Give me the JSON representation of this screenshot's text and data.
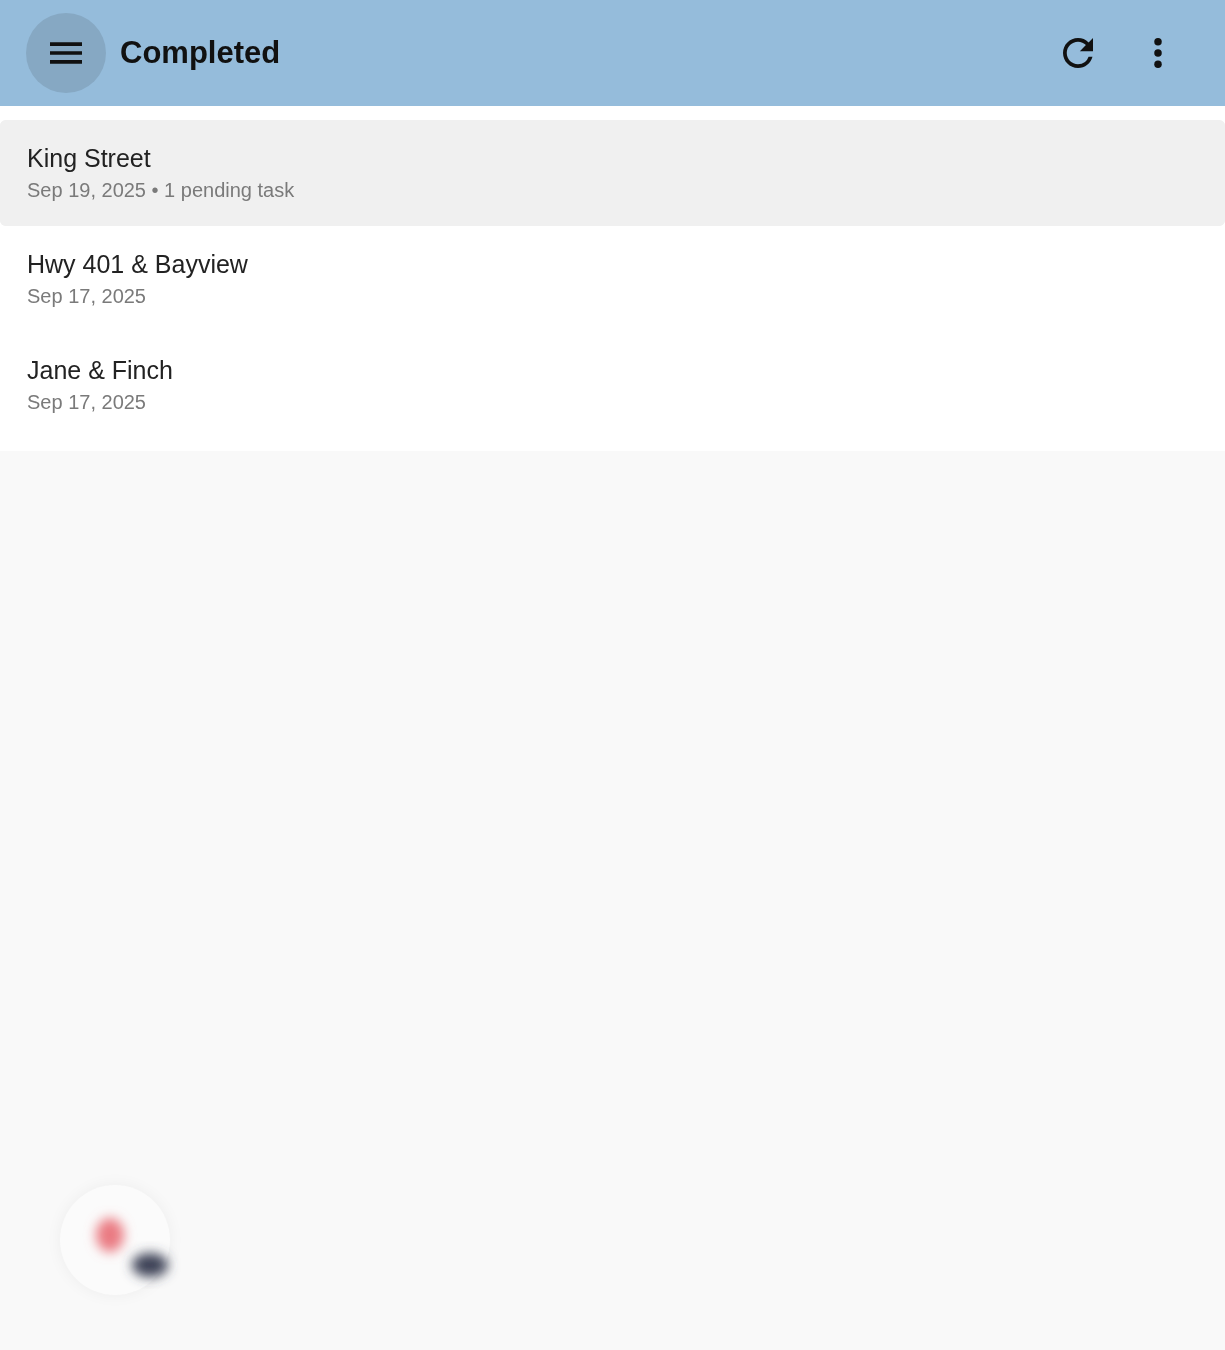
{
  "app_bar": {
    "title": "Completed"
  },
  "sites": [
    {
      "title": "King Street",
      "subtitle": "Sep 19, 2025 • 1 pending task",
      "selected": true
    },
    {
      "title": "Hwy 401 & Bayview",
      "subtitle": "Sep 17, 2025",
      "selected": false
    },
    {
      "title": "Jane & Finch",
      "subtitle": "Sep 17, 2025",
      "selected": false
    }
  ]
}
